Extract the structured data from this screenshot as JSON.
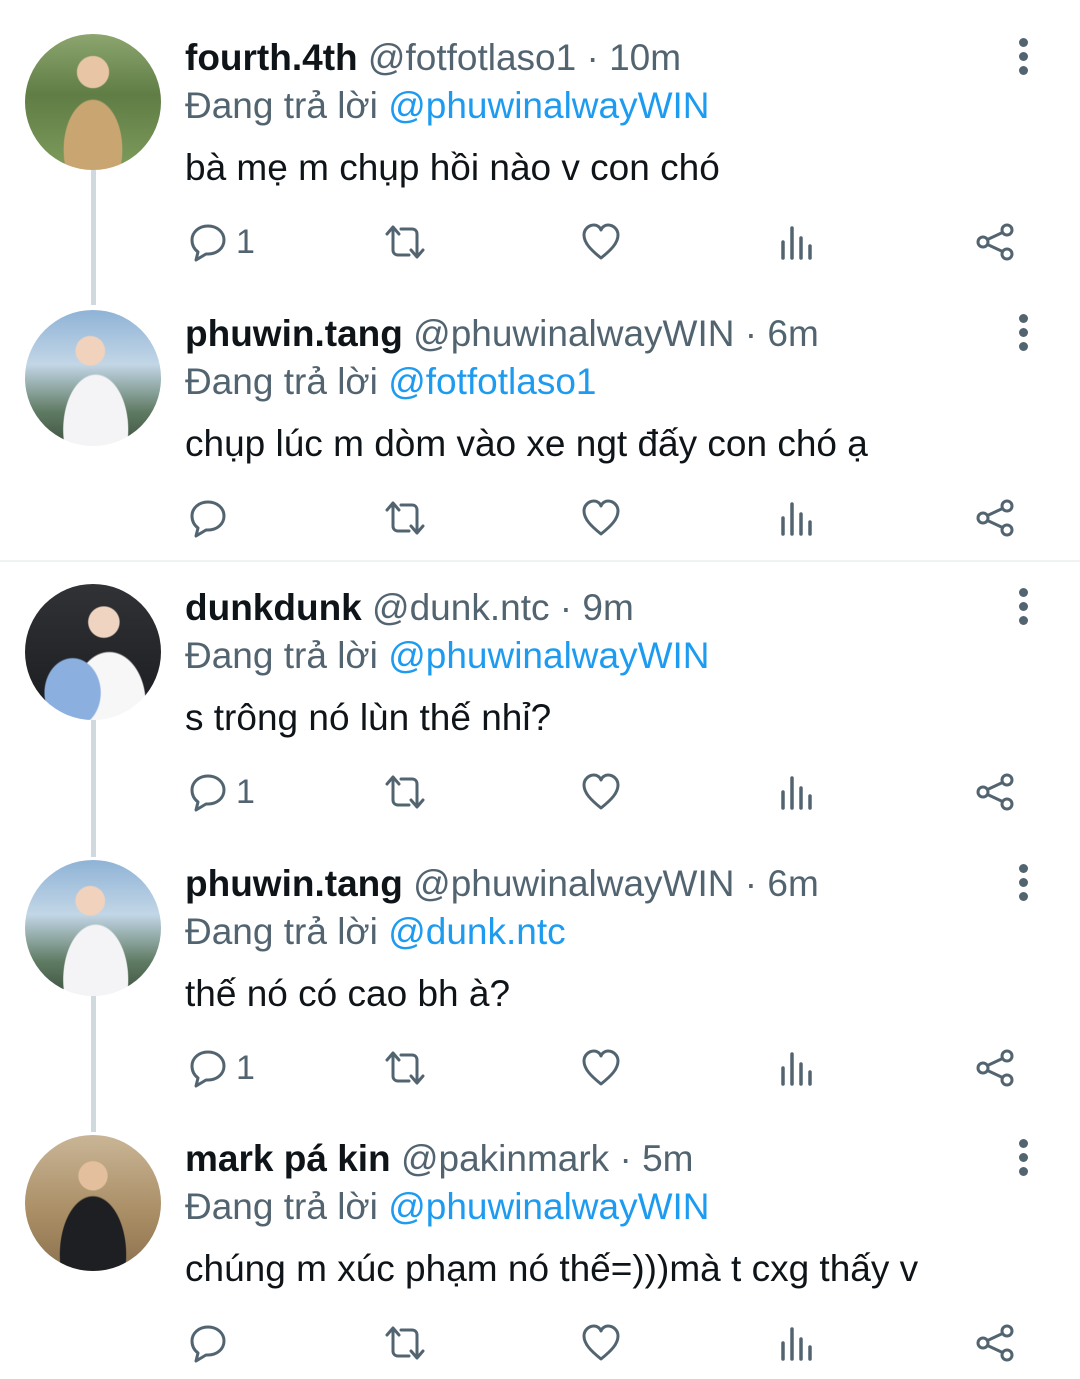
{
  "tweets": [
    {
      "name": "fourth.4th",
      "handle": "@fotfotlaso1",
      "sep": "·",
      "time": "10m",
      "reply_prefix": "Đang trả lời",
      "reply_to": "@phuwinalwayWIN",
      "text": "bà mẹ m chụp hồi nào v con chó",
      "reply_count": "1"
    },
    {
      "name": "phuwin.tang",
      "handle": "@phuwinalwayWIN",
      "sep": "·",
      "time": "6m",
      "reply_prefix": "Đang trả lời",
      "reply_to": "@fotfotlaso1",
      "text": "chụp lúc m dòm vào xe ngt đấy con chó ạ",
      "reply_count": ""
    },
    {
      "name": "dunkdunk",
      "handle": "@dunk.ntc",
      "sep": "·",
      "time": "9m",
      "reply_prefix": "Đang trả lời",
      "reply_to": "@phuwinalwayWIN",
      "text": "s trông nó lùn thế nhỉ?",
      "reply_count": "1"
    },
    {
      "name": "phuwin.tang",
      "handle": "@phuwinalwayWIN",
      "sep": "·",
      "time": "6m",
      "reply_prefix": "Đang trả lời",
      "reply_to": "@dunk.ntc",
      "text": "thế nó có cao bh à?",
      "reply_count": "1"
    },
    {
      "name": "mark pá kin",
      "handle": "@pakinmark",
      "sep": "·",
      "time": "5m",
      "reply_prefix": "Đang trả lời",
      "reply_to": "@phuwinalwayWIN",
      "text": "chúng m xúc phạm nó thế=)))mà t cxg thấy v",
      "reply_count": ""
    }
  ],
  "icons": {
    "reply": "reply-icon",
    "retweet": "retweet-icon",
    "like": "like-icon",
    "views": "views-icon",
    "share": "share-icon",
    "more": "more-options-icon"
  },
  "colors": {
    "link": "#1d9bf0",
    "text": "#0f1419",
    "muted": "#536471",
    "thread_line": "#cfd9de"
  }
}
